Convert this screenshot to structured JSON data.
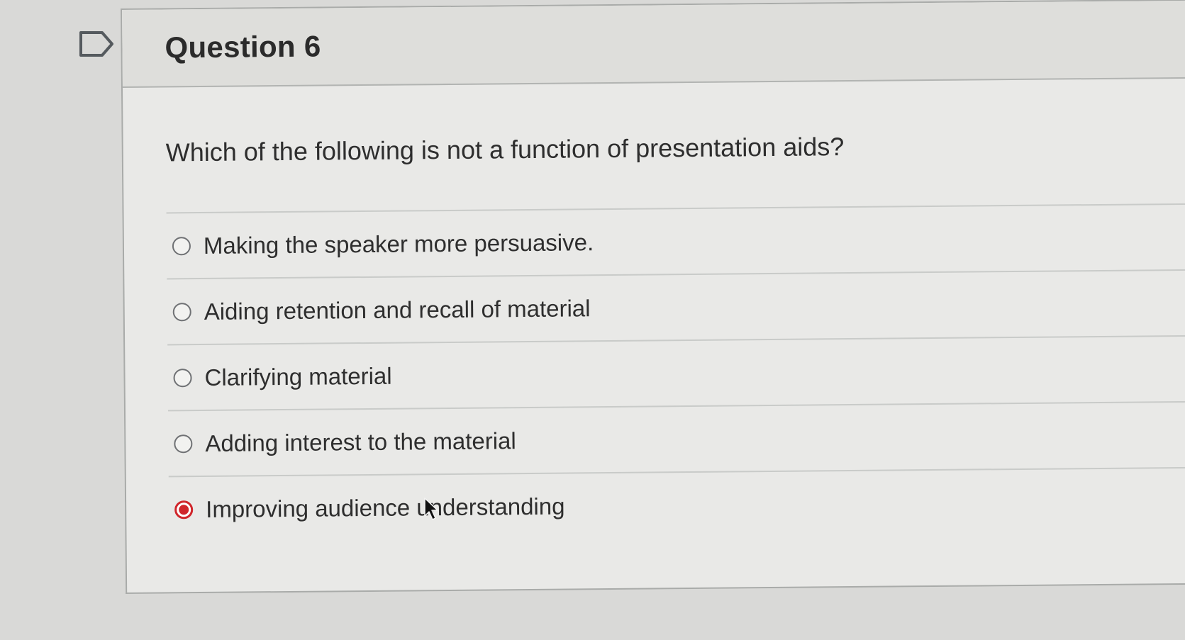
{
  "question": {
    "title": "Question 6",
    "text": "Which of the following is not a function of presentation aids?",
    "answers": [
      {
        "label": "Making the speaker more persuasive.",
        "selected": false
      },
      {
        "label": "Aiding retention and recall of material",
        "selected": false
      },
      {
        "label": "Clarifying material",
        "selected": false
      },
      {
        "label": "Adding interest to the material",
        "selected": false
      },
      {
        "label": "Improving audience understanding",
        "selected": true
      }
    ]
  },
  "colors": {
    "selected_radio": "#d0262b",
    "page_background": "#d9d9d7",
    "card_background": "#e9e9e7"
  },
  "icons": {
    "flag": "bookmark-flag-icon",
    "pointer": "mouse-pointer-icon"
  }
}
